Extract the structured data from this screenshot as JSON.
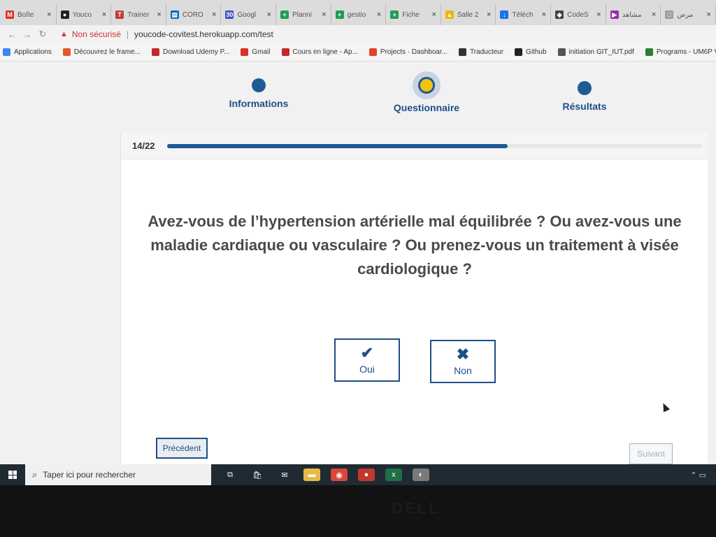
{
  "browser": {
    "tabs": [
      {
        "label": "Boîte",
        "color": "#d93025",
        "glyph": "M"
      },
      {
        "label": "Youco",
        "color": "#222222",
        "glyph": "●"
      },
      {
        "label": "Trainer",
        "color": "#c23b3b",
        "glyph": "T"
      },
      {
        "label": "CORO",
        "color": "#0067b8",
        "glyph": "▤"
      },
      {
        "label": "Googl",
        "color": "#3c4dc4",
        "glyph": "30"
      },
      {
        "label": "Planni",
        "color": "#1f9d55",
        "glyph": "+"
      },
      {
        "label": "gestio",
        "color": "#1f9d55",
        "glyph": "+"
      },
      {
        "label": "Fiche",
        "color": "#1f9d55",
        "glyph": "+"
      },
      {
        "label": "Salle 2",
        "color": "#f4b400",
        "glyph": "▲"
      },
      {
        "label": "Téléch",
        "color": "#1a73e8",
        "glyph": "↓"
      },
      {
        "label": "CodeS",
        "color": "#444444",
        "glyph": "◆"
      },
      {
        "label": "مشاهد",
        "color": "#9c27b0",
        "glyph": "▶"
      },
      {
        "label": "مرض",
        "color": "#9e9e9e",
        "glyph": "□"
      }
    ],
    "address": {
      "insecure_label": "Non sécurisé",
      "url": "youcode-covitest.herokuapp.com/test"
    },
    "bookmarks": [
      {
        "label": "Applications",
        "color": "#4285f4"
      },
      {
        "label": "Découvrez le frame...",
        "color": "#e8572a"
      },
      {
        "label": "Download Udemy P...",
        "color": "#c62828"
      },
      {
        "label": "Gmail",
        "color": "#d93025"
      },
      {
        "label": "Cours en ligne - Ap...",
        "color": "#c62828"
      },
      {
        "label": "Projects · Dashboar...",
        "color": "#e24329"
      },
      {
        "label": "Traducteur",
        "color": "#333333"
      },
      {
        "label": "Github",
        "color": "#222222"
      },
      {
        "label": "initiation GIT_IUT.pdf",
        "color": "#555555"
      },
      {
        "label": "Programs - UM6P V...",
        "color": "#2e7d32"
      }
    ]
  },
  "steps": [
    {
      "label": "Informations",
      "active": false
    },
    {
      "label": "Questionnaire",
      "active": true
    },
    {
      "label": "Résultats",
      "active": false
    }
  ],
  "progress": {
    "counter": "14/22",
    "current": 14,
    "total": 22
  },
  "question": "Avez-vous de l’hypertension artérielle mal équilibrée ? Ou avez-vous une maladie cardiaque ou vasculaire ? Ou prenez-vous un traitement à visée cardiologique ?",
  "answers": {
    "yes_label": "Oui",
    "no_label": "Non"
  },
  "navigation": {
    "prev_label": "Précédent",
    "next_label": "Suivant"
  },
  "taskbar": {
    "search_placeholder": "Taper ici pour rechercher",
    "apps": [
      {
        "name": "task-view",
        "color": "#1f2a33"
      },
      {
        "name": "store",
        "color": "#1f2a33"
      },
      {
        "name": "mail",
        "color": "#1f2a33"
      },
      {
        "name": "file-explorer",
        "color": "#e8b84a"
      },
      {
        "name": "chrome",
        "color": "#db4437"
      },
      {
        "name": "app-red",
        "color": "#c0392b"
      },
      {
        "name": "excel",
        "color": "#1e7145"
      },
      {
        "name": "app-grey",
        "color": "#7a7a7a"
      }
    ]
  },
  "theme": {
    "primary": "#1e5a93",
    "accent": "#f1c40f"
  }
}
